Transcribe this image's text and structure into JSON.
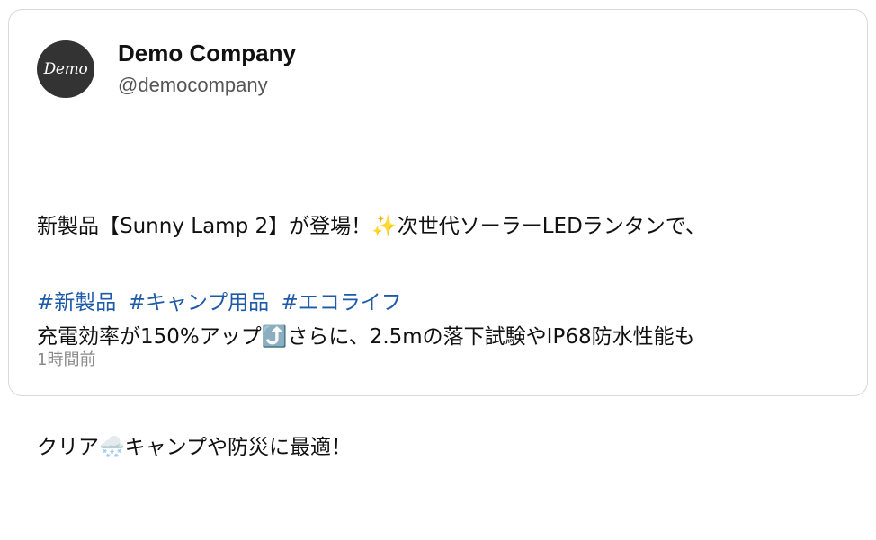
{
  "account": {
    "avatar_text": "Demo",
    "display_name": "Demo Company",
    "handle": "@democompany"
  },
  "post": {
    "line1": "新製品【Sunny Lamp 2】が登場！✨次世代ソーラーLEDランタンで、",
    "line2": "充電効率が150%アップ⤴️さらに、2.5mの落下試験やIP68防水性能も",
    "line3": "クリア🌨️キャンプや防災に最適！",
    "hashtags": [
      "#新製品",
      "#キャンプ用品",
      "#エコライフ"
    ],
    "timestamp": "1時間前"
  },
  "colors": {
    "hashtag": "#1d5aa8",
    "avatar_bg": "#333333",
    "border": "#d9d9d9"
  }
}
